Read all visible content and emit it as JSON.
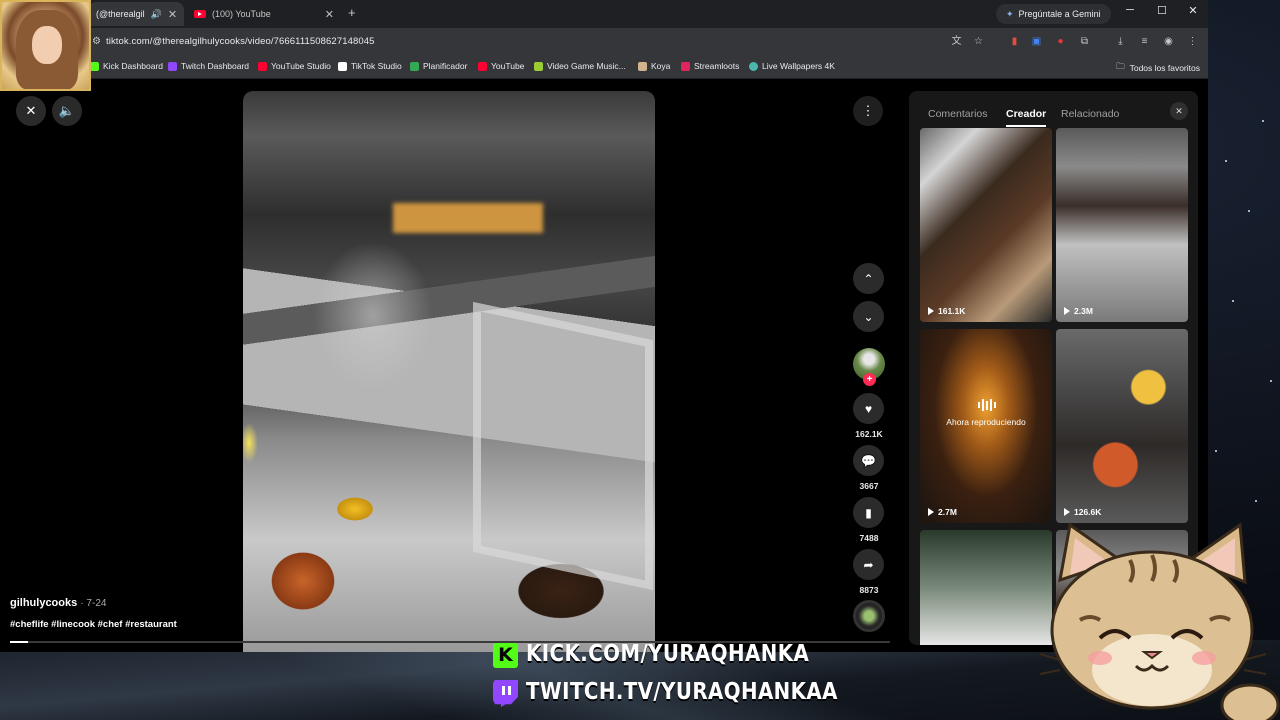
{
  "browser": {
    "tabs": [
      {
        "label": "(@therealgil"
      },
      {
        "label": "(100) YouTube"
      }
    ],
    "gemini_label": "Pregúntale a Gemini",
    "url": "tiktok.com/@therealgilhulycooks/video/7666111508627148045",
    "bookmarks": [
      {
        "label": "Kick Dashboard",
        "color": "#53fc18"
      },
      {
        "label": "Twitch Dashboard",
        "color": "#9146ff"
      },
      {
        "label": "YouTube Studio",
        "color": "#ff0033"
      },
      {
        "label": "TikTok Studio",
        "color": "#ffffff"
      },
      {
        "label": "Planificador",
        "color": "#34a853"
      },
      {
        "label": "YouTube",
        "color": "#ff0033"
      },
      {
        "label": "Video Game Music...",
        "color": "#9acd32"
      },
      {
        "label": "Koya",
        "color": "#d2b48c"
      },
      {
        "label": "Streamloots",
        "color": "#e0245e"
      },
      {
        "label": "Live Wallpapers 4K",
        "color": "#4db6ac"
      }
    ],
    "bookmarks_all": "Todos los favoritos"
  },
  "video": {
    "author": "gilhulycooks",
    "date": "· 7-24",
    "hashtags": "#cheflife #linecook #chef #restaurant",
    "progress": 0.02
  },
  "actions": {
    "likes": "162.1K",
    "comments": "3667",
    "saves": "7488",
    "shares": "8873"
  },
  "panel": {
    "tabs": [
      "Comentarios",
      "Creador",
      "Relacionado"
    ],
    "active_tab": "Creador",
    "thumbnails": [
      {
        "views": "161.1K"
      },
      {
        "views": "2.3M"
      },
      {
        "views": "2.7M",
        "status": "Ahora reproduciendo"
      },
      {
        "views": "126.6K"
      }
    ]
  },
  "overlay": {
    "kick": "KICK.COM/YURAQHANKA",
    "twitch": "TWITCH.TV/YURAQHANKAA"
  },
  "colors": {
    "kick": "#53fc18",
    "twitch": "#9146ff",
    "tiktok_red": "#fe2c55"
  }
}
